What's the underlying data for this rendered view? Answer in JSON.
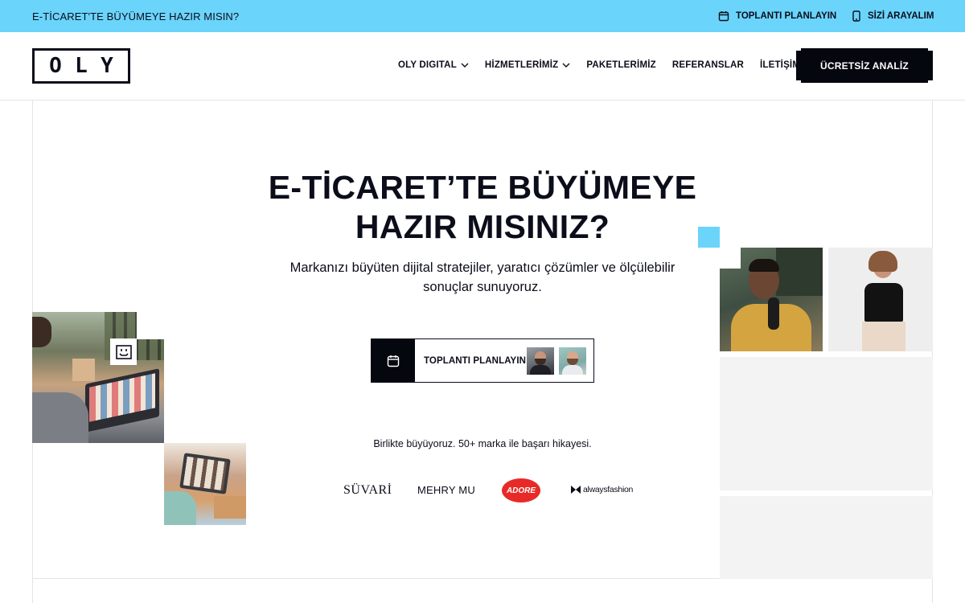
{
  "topbar": {
    "title": "E-TİCARET'TE BÜYÜMEYE HAZIR MISIN?",
    "links": [
      {
        "label": "TOPLANTI PLANLAYIN",
        "icon": "calendar-icon"
      },
      {
        "label": "SİZİ ARAYALIM",
        "icon": "phone-icon"
      }
    ]
  },
  "header": {
    "logo_letters": [
      "O",
      "L",
      "Y"
    ],
    "nav": [
      {
        "label": "OLY DIGITAL",
        "dropdown": true
      },
      {
        "label": "HİZMETLERİMİZ",
        "dropdown": true
      },
      {
        "label": "PAKETLERİMİZ",
        "dropdown": false
      },
      {
        "label": "REFERANSLAR",
        "dropdown": false
      },
      {
        "label": "İLETİŞİM",
        "dropdown": false
      }
    ],
    "cta": "ÜCRETSİZ ANALİZ"
  },
  "hero": {
    "title_line1": "E-TİCARET’TE BÜYÜMEYE",
    "title_line2": "HAZIR MISINIZ?",
    "subtitle_line1": "Markanızı büyüten dijital stratejiler, yaratıcı çözümler ve ölçülebilir",
    "subtitle_line2": "sonuçlar sunuyoruz.",
    "meeting_button": "TOPLANTI PLANLAYIN",
    "brands_caption": "Birlikte büyüyoruz. 50+ marka ile başarı hikayesi.",
    "brands": {
      "suvari": "SÜVARİ",
      "mehry": "MEHRY MU",
      "adore": "ADORE",
      "always": "alwaysfashion"
    }
  },
  "colors": {
    "accent_blue": "#6bd4fb",
    "dark": "#05070f"
  }
}
